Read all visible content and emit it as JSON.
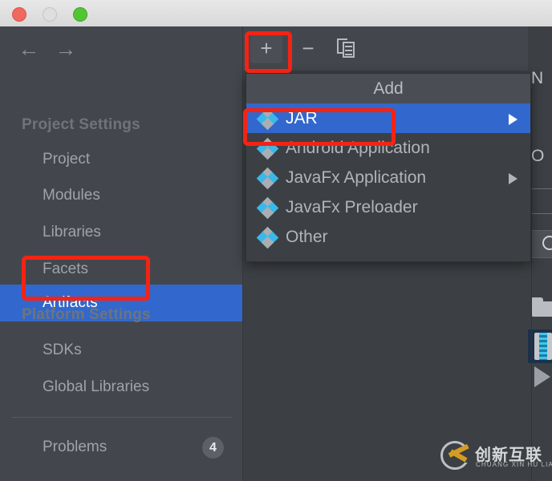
{
  "window": {
    "traffic_lights": [
      "close",
      "minimize",
      "maximize"
    ],
    "colors": {
      "close": "#ee6a5f",
      "minimize": "#dedede",
      "maximize": "#52c533",
      "accent_selection": "#3268cd",
      "annotation_red": "#f42314",
      "sidebar_bg": "#43474d",
      "content_bg": "#3c4044"
    }
  },
  "sidebar": {
    "nav": {
      "back": "←",
      "forward": "→"
    },
    "sections": [
      {
        "heading": "Project Settings",
        "items": [
          {
            "label": "Project",
            "selected": false
          },
          {
            "label": "Modules",
            "selected": false
          },
          {
            "label": "Libraries",
            "selected": false
          },
          {
            "label": "Facets",
            "selected": false
          },
          {
            "label": "Artifacts",
            "selected": true
          }
        ]
      },
      {
        "heading": "Platform Settings",
        "items": [
          {
            "label": "SDKs",
            "selected": false
          },
          {
            "label": "Global Libraries",
            "selected": false
          }
        ]
      }
    ],
    "problems": {
      "label": "Problems",
      "count": "4"
    }
  },
  "toolbar": {
    "add_label": "+",
    "remove_label": "−",
    "copy_label": "copy-icon"
  },
  "add_menu": {
    "title": "Add",
    "items": [
      {
        "label": "JAR",
        "selected": true,
        "has_submenu": true
      },
      {
        "label": "Android Application",
        "selected": false,
        "has_submenu": false
      },
      {
        "label": "JavaFx Application",
        "selected": false,
        "has_submenu": true
      },
      {
        "label": "JavaFx Preloader",
        "selected": false,
        "has_submenu": false
      },
      {
        "label": "Other",
        "selected": false,
        "has_submenu": false
      }
    ]
  },
  "right_panel": {
    "name_label": "N",
    "output_label": "O",
    "icons": [
      "folder-icon",
      "jar-archive-icon",
      "play-triangle-icon"
    ]
  },
  "annotations": [
    {
      "name": "add-button-highlight"
    },
    {
      "name": "jar-menu-item-highlight"
    },
    {
      "name": "artifacts-sidebar-highlight"
    }
  ],
  "watermark": {
    "chinese": "创新互联",
    "pinyin": "CHUANG XIN HU LIAN"
  }
}
